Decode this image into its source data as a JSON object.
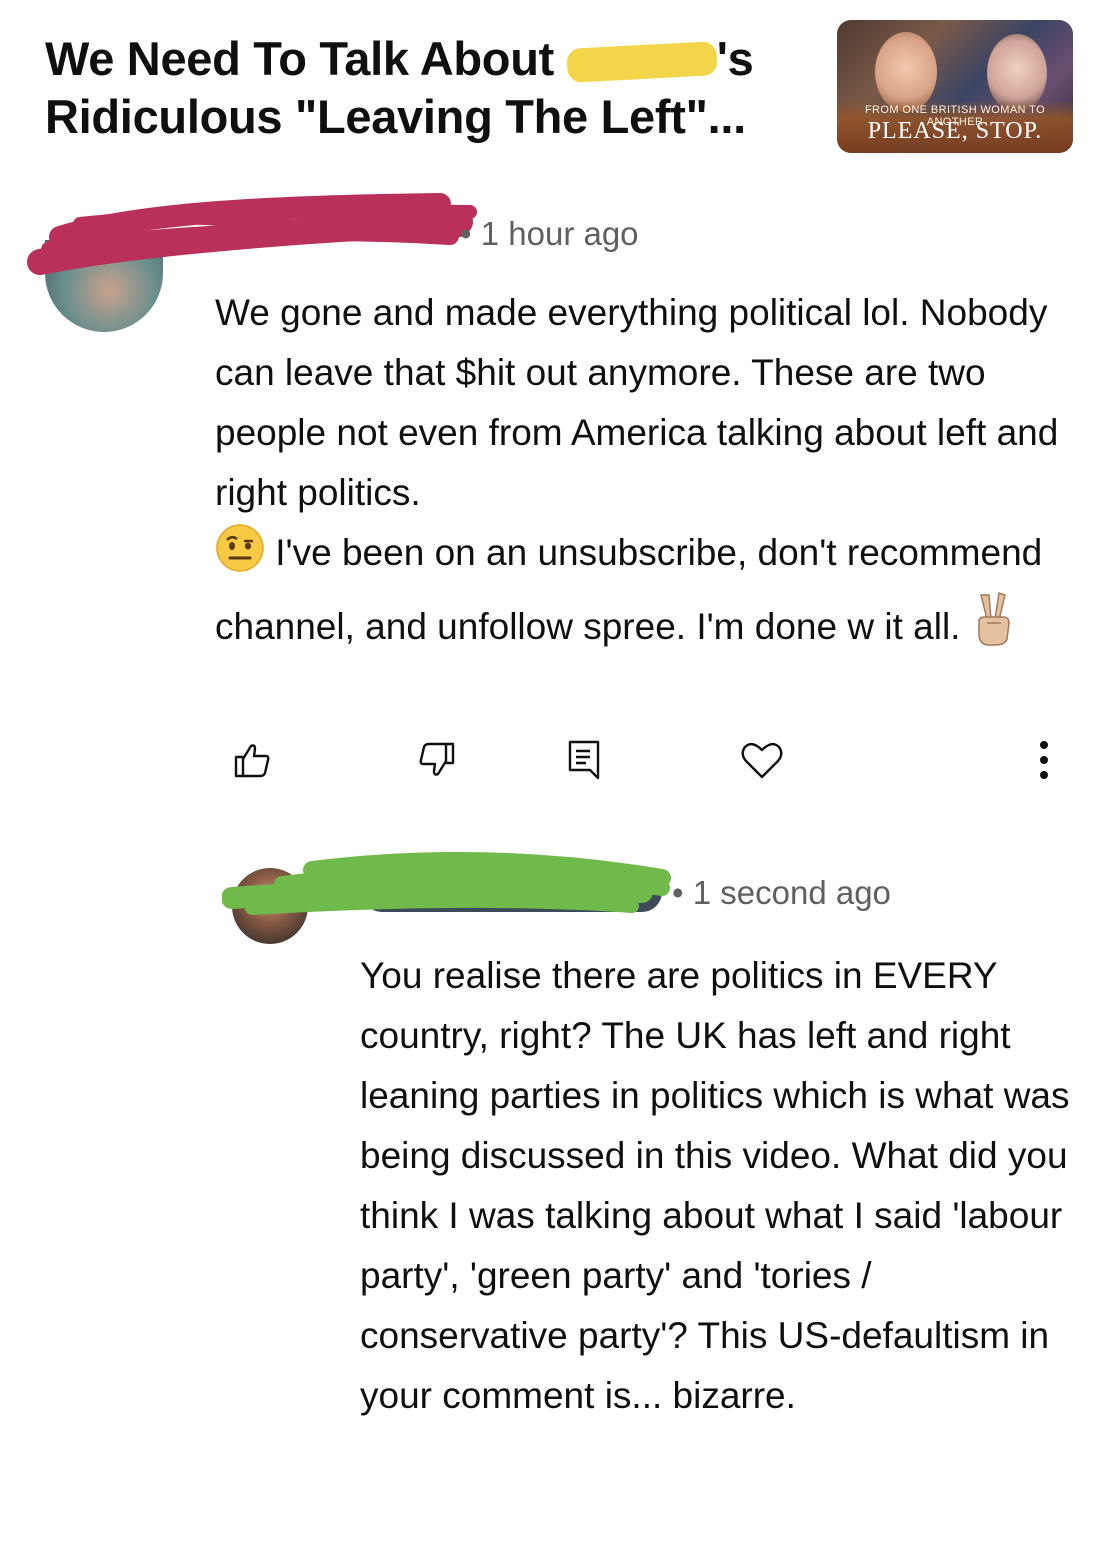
{
  "video": {
    "title_line1_prefix": "We Need To Talk About",
    "title_line1_suffix": "'s",
    "title_line2": "Ridiculous \"Leaving The Left\"...",
    "thumbnail_caption_small": "From one British woman to another",
    "thumbnail_caption_big": "Please, stop."
  },
  "comments": [
    {
      "time": "1 hour ago",
      "text": "We gone and made everything political lol. Nobody can leave that $hit out anymore. These are two people not even from America talking about left and right politics.",
      "text_after_emoji": "I've been on an unsubscribe, don't recommend channel, and unfollow spree. I'm done w it all.",
      "emoji_1": "raised-eyebrow-face",
      "emoji_2": "victory-hand",
      "actions": [
        "like-icon",
        "dislike-icon",
        "reply-icon",
        "heart-icon",
        "more-icon"
      ]
    },
    {
      "time": "1 second ago",
      "text": "You realise there are politics in EVERY country, right? The UK has left and right leaning parties in politics which is what was being discussed in this video. What did you think I was talking about what I said 'labour party', 'green party' and 'tories / conservative party'? This US-defaultism in your comment is... bizarre."
    }
  ],
  "colors": {
    "meta_text": "#606060",
    "redact_red": "#b9305a",
    "redact_green": "#6fba4a",
    "redact_yellow": "#f3d54a"
  }
}
